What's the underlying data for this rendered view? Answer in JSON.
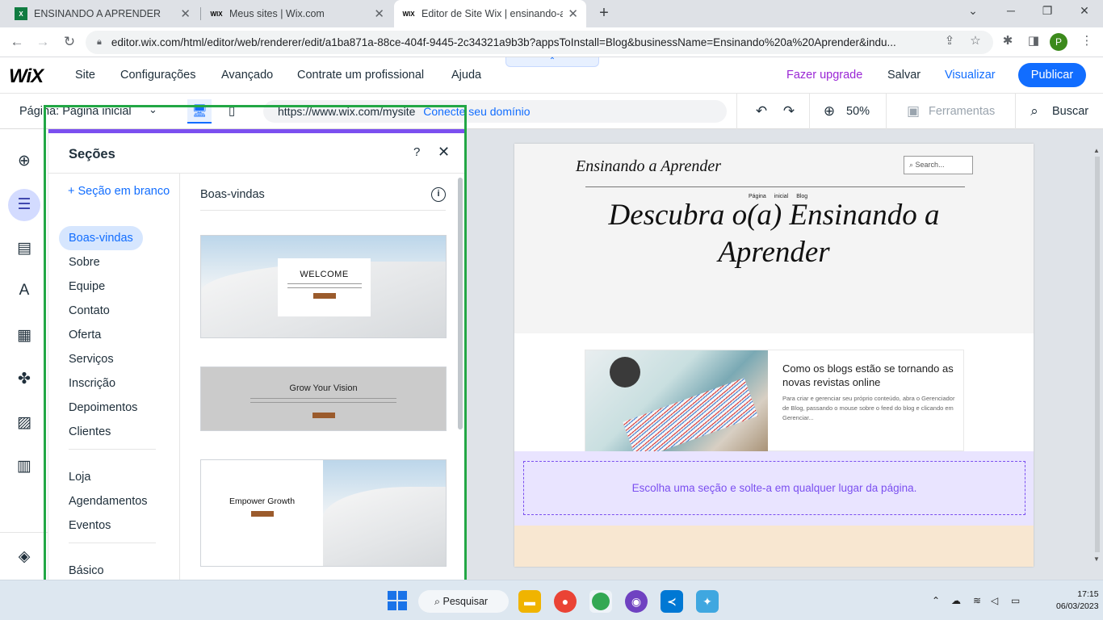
{
  "browser": {
    "tabs": [
      {
        "title": "ENSINANDO A APRENDER",
        "favicon": "excel-icon"
      },
      {
        "title": "Meus sites | Wix.com",
        "favicon": "wix-icon"
      },
      {
        "title": "Editor de Site Wix | ensinando-a-",
        "favicon": "wix-icon"
      }
    ],
    "url": "editor.wix.com/html/editor/web/renderer/edit/a1ba871a-88ce-404f-9445-2c34321a9b3b?appsToInstall=Blog&businessName=Ensinando%20a%20Aprender&indu...",
    "profile_initial": "P"
  },
  "wix": {
    "logo": "WiX",
    "menu": [
      "Site",
      "Configurações",
      "Avançado",
      "Contrate um profissional",
      "Ajuda"
    ],
    "upgrade": "Fazer upgrade",
    "save": "Salvar",
    "preview": "Visualizar",
    "publish": "Publicar",
    "page_label": "Página: Página inicial",
    "site_url": "https://www.wix.com/mysite",
    "connect_domain": "Conecte seu domínio",
    "zoom": "50%",
    "tools": "Ferramentas",
    "search": "Buscar"
  },
  "panel": {
    "title": "Seções",
    "help": "?",
    "blank_section": "+ Seção em branco",
    "categories_group1": [
      "Boas-vindas",
      "Sobre",
      "Equipe",
      "Contato",
      "Oferta",
      "Serviços",
      "Inscrição",
      "Depoimentos",
      "Clientes"
    ],
    "categories_group2": [
      "Loja",
      "Agendamentos",
      "Eventos"
    ],
    "categories_group3": [
      "Básico"
    ],
    "active_category": "Boas-vindas",
    "content_heading": "Boas-vindas",
    "thumbnails": [
      {
        "title": "WELCOME"
      },
      {
        "title": "Grow Your Vision"
      },
      {
        "title": "Empower Growth"
      }
    ]
  },
  "site": {
    "name": "Ensinando a Aprender",
    "search_placeholder": "Search...",
    "nav": "Página inicial Blog",
    "hero": "Descubra o(a) Ensinando a Aprender",
    "post_title": "Como os blogs estão se tornando as novas revistas online",
    "post_excerpt": "Para criar e gerenciar seu próprio conteúdo, abra o Gerenciador de Blog, passando o mouse sobre o feed do blog e clicando em Gerenciar...",
    "drop_hint": "Escolha uma seção e solte-a em qualquer lugar da página."
  },
  "taskbar": {
    "search": "Pesquisar",
    "time": "17:15",
    "date": "06/03/2023"
  },
  "colors": {
    "wix_blue": "#116dff",
    "upgrade_purple": "#9a27d5",
    "highlight_green": "#22a745",
    "section_purple": "#7b4ff0"
  }
}
